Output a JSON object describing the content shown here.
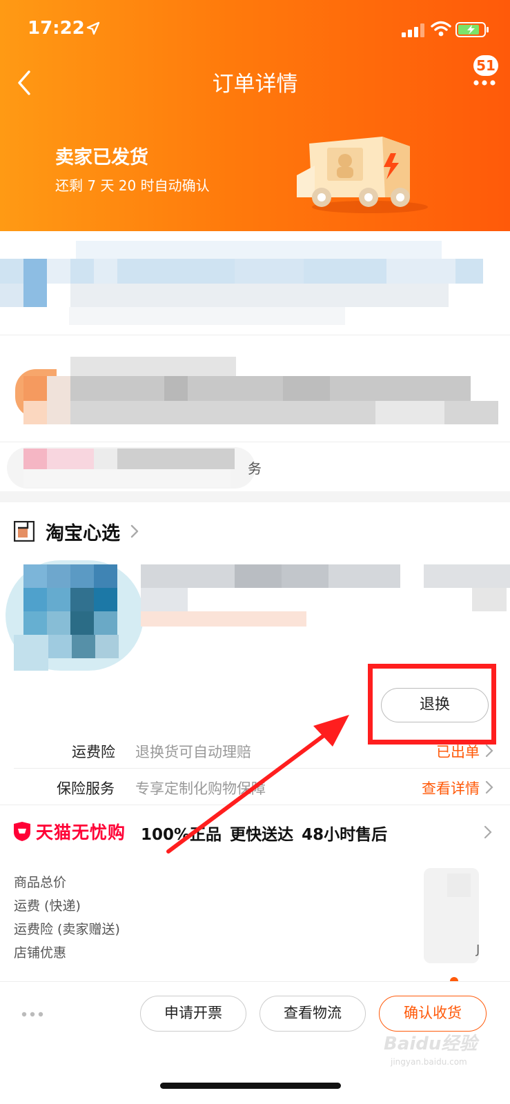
{
  "status_bar": {
    "time": "17:22"
  },
  "nav": {
    "title": "订单详情",
    "badge_count": "51"
  },
  "shipping": {
    "title": "卖家已发货",
    "subtitle": "还剩 7 天 20 时自动确认"
  },
  "obscured": {
    "service_fragment": "务"
  },
  "shop": {
    "name": "淘宝心选"
  },
  "item": {
    "return_label": "退换"
  },
  "insurance_rows": [
    {
      "label": "运费险",
      "desc": "退换货可自动理赔",
      "action": "已出单"
    },
    {
      "label": "保险服务",
      "desc": "专享定制化购物保障",
      "action": "查看详情"
    }
  ],
  "tmall": {
    "brand": "天猫无忧购",
    "perks": "100%正品 更快送达 48小时售后"
  },
  "price_rows": [
    "商品总价",
    "运费 (快递)",
    "运费险 (卖家赠送)",
    "店铺优惠"
  ],
  "price_value_fragment": "J",
  "bottom_bar": {
    "invoice_label": "申请开票",
    "logistics_label": "查看物流",
    "confirm_label": "确认收货"
  },
  "watermark": {
    "main": "Baidu经验",
    "sub": "jingyan.baidu.com"
  },
  "colors": {
    "brand_orange": "#ff5a0a",
    "tmall_red": "#ff0036",
    "highlight_red": "#ff1e1e"
  }
}
